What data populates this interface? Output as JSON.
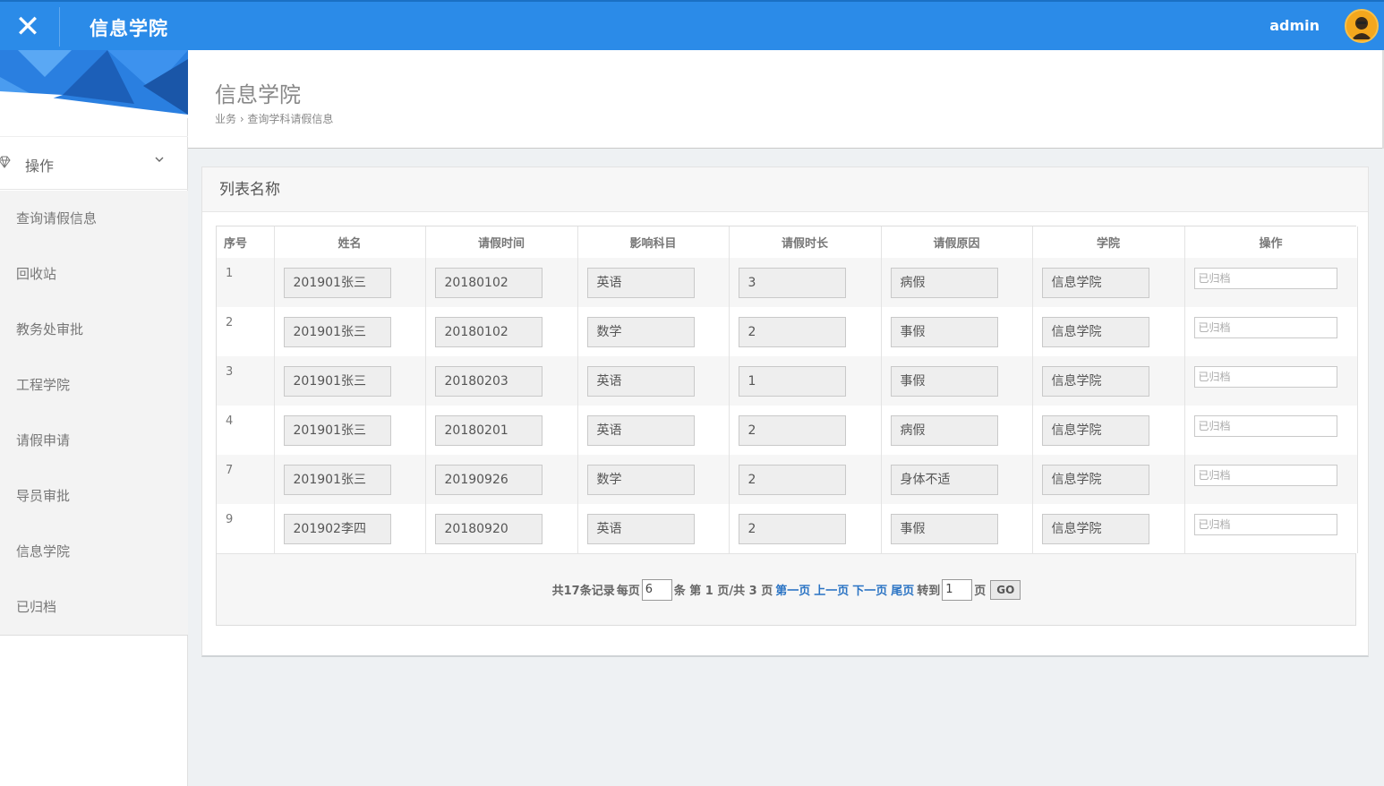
{
  "header": {
    "close_glyph": "✕",
    "app_title": "信息学院",
    "user_name": "admin"
  },
  "sidebar": {
    "group_label": "操作",
    "items": [
      {
        "label": "查询请假信息"
      },
      {
        "label": "回收站"
      },
      {
        "label": "教务处审批"
      },
      {
        "label": "工程学院"
      },
      {
        "label": "请假申请"
      },
      {
        "label": "导员审批"
      },
      {
        "label": "信息学院"
      },
      {
        "label": "已归档"
      }
    ]
  },
  "page": {
    "title": "信息学院",
    "breadcrumb": "业务 › 查询学科请假信息"
  },
  "panel": {
    "title": "列表名称",
    "columns": [
      "序号",
      "姓名",
      "请假时间",
      "影响科目",
      "请假时长",
      "请假原因",
      "学院",
      "操作"
    ],
    "rows": [
      {
        "id": "1",
        "name": "201901张三",
        "date": "20180102",
        "subject": "英语",
        "duration": "3",
        "reason": "病假",
        "college": "信息学院",
        "status_placeholder": "已归档"
      },
      {
        "id": "2",
        "name": "201901张三",
        "date": "20180102",
        "subject": "数学",
        "duration": "2",
        "reason": "事假",
        "college": "信息学院",
        "status_placeholder": "已归档"
      },
      {
        "id": "3",
        "name": "201901张三",
        "date": "20180203",
        "subject": "英语",
        "duration": "1",
        "reason": "事假",
        "college": "信息学院",
        "status_placeholder": "已归档"
      },
      {
        "id": "4",
        "name": "201901张三",
        "date": "20180201",
        "subject": "英语",
        "duration": "2",
        "reason": "病假",
        "college": "信息学院",
        "status_placeholder": "已归档"
      },
      {
        "id": "7",
        "name": "201901张三",
        "date": "20190926",
        "subject": "数学",
        "duration": "2",
        "reason": "身体不适",
        "college": "信息学院",
        "status_placeholder": "已归档"
      },
      {
        "id": "9",
        "name": "201902李四",
        "date": "20180920",
        "subject": "英语",
        "duration": "2",
        "reason": "事假",
        "college": "信息学院",
        "status_placeholder": "已归档"
      }
    ]
  },
  "pager": {
    "total_text": "共17条记录",
    "per_page_label": "每页",
    "per_page_value": "6",
    "page_info": "条 第 1 页/共 3 页",
    "first": "第一页",
    "prev": "上一页",
    "next": "下一页",
    "last": "尾页",
    "goto_label": "转到",
    "goto_value": "1",
    "page_suffix": "页",
    "go_label": "GO"
  },
  "colors": {
    "topbar": "#2b8be8",
    "link": "#2b74c4",
    "banner_blue": "#2a7fe0"
  }
}
